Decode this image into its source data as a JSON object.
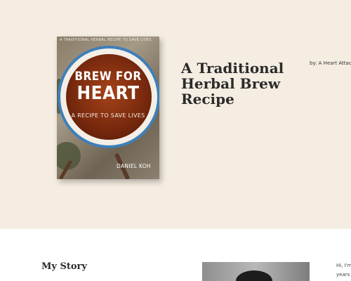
{
  "hero": {
    "book": {
      "tagline": "A TRADITIONAL HERBAL RECIPE TO SAVE LIVES",
      "title_line1": "BREW FOR",
      "title_line2": "HEART",
      "subtitle": "A RECIPE TO SAVE LIVES",
      "author": "DANIEL KOH"
    },
    "title": "A Traditional Herbal Brew Recipe",
    "byline": "by: A Heart Attack"
  },
  "story": {
    "heading": "My Story",
    "intro_line1": "Hi, I'm",
    "intro_line2": "years o"
  },
  "colors": {
    "hero_bg": "#f5ede2",
    "bowl_blue": "#3f7fb8",
    "tea": "#7a2a0e"
  }
}
